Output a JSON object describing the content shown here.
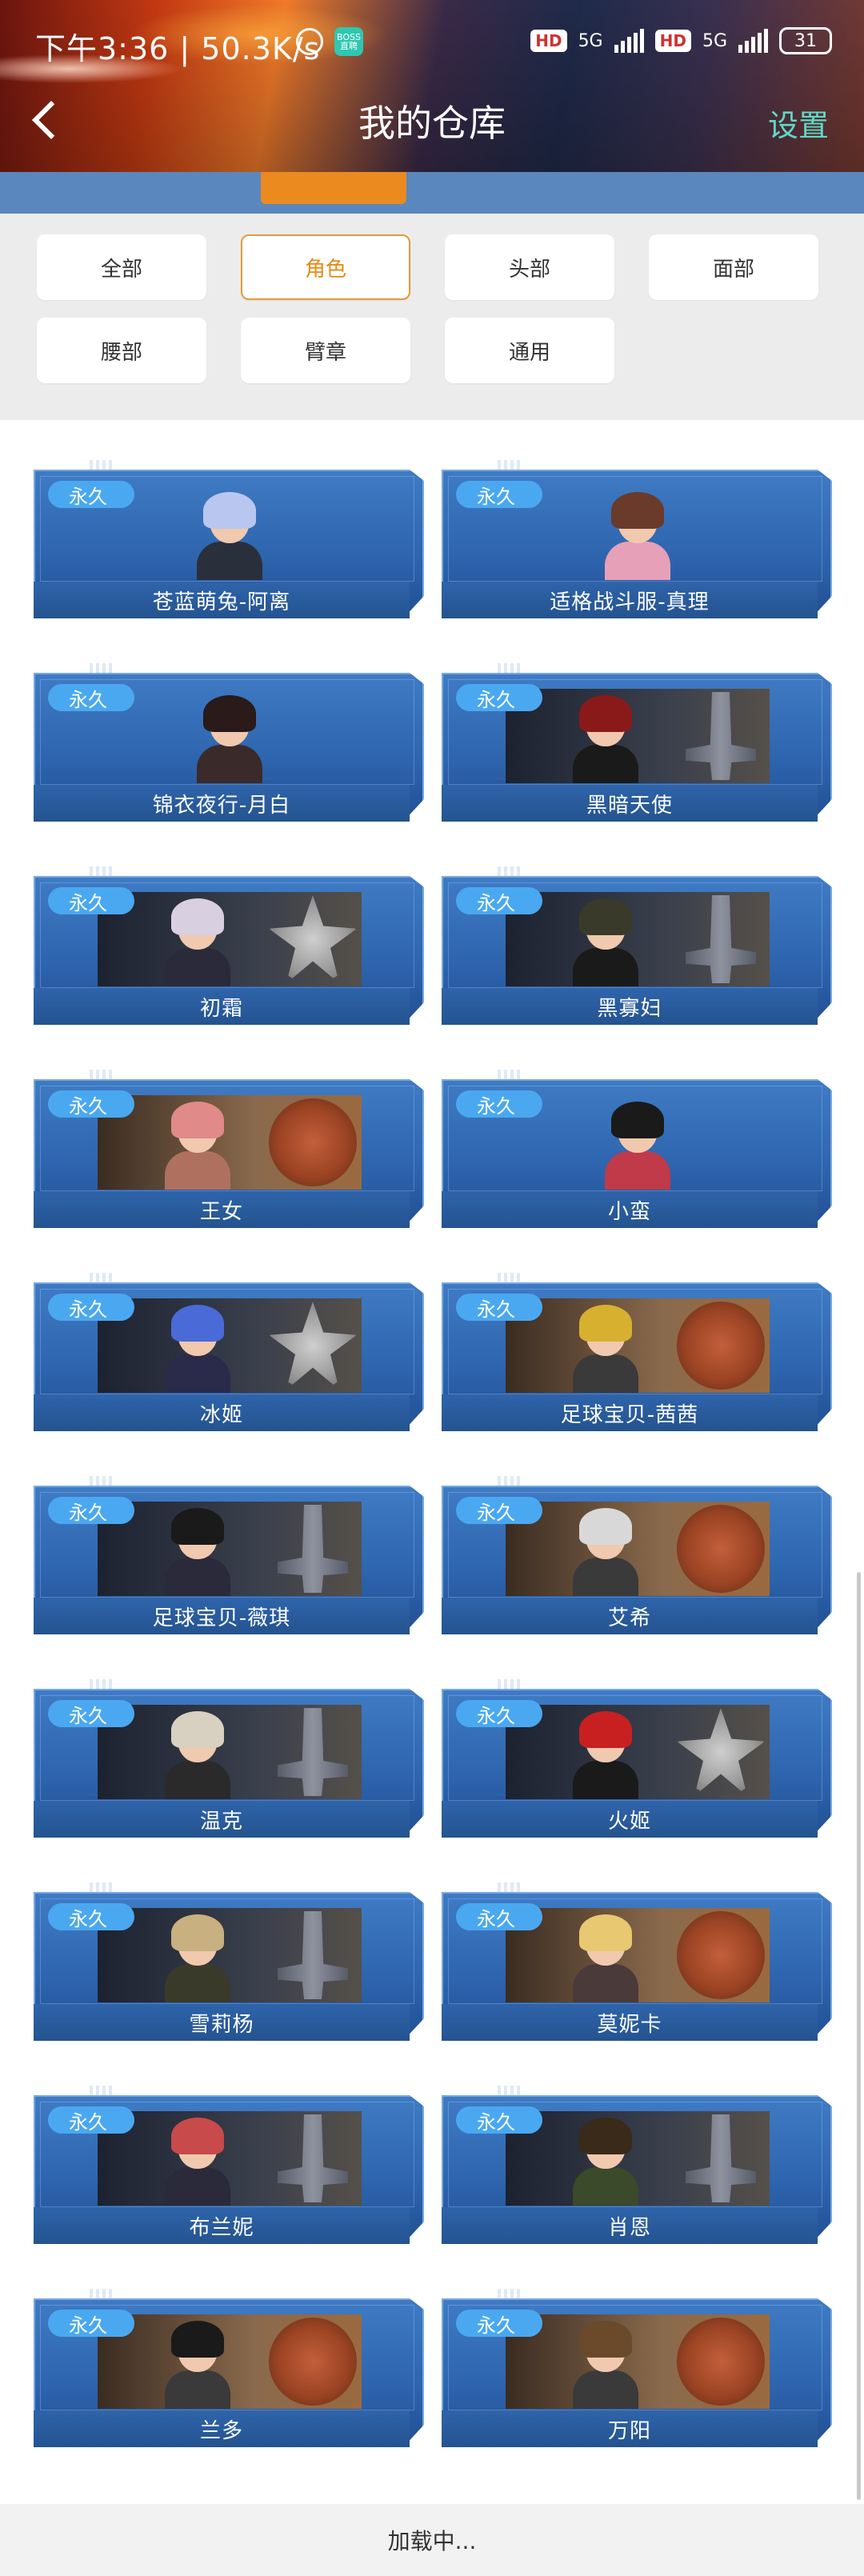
{
  "status_bar": {
    "time_speed": "下午3:36 | 50.3K/s",
    "boss_badge": "BOSS直聘",
    "hd1": "HD",
    "hd2": "HD",
    "net1": "5G",
    "net2": "5G",
    "battery": "31"
  },
  "header": {
    "title": "我的仓库",
    "settings": "设置"
  },
  "filters": {
    "active": "角色",
    "chips": [
      "全部",
      "角色",
      "头部",
      "面部",
      "腰部",
      "臂章",
      "通用"
    ]
  },
  "badge_label": "永久",
  "items": [
    {
      "name": "苍蓝萌兔-阿离",
      "label": "永久"
    },
    {
      "name": "适格战斗服-真理",
      "label": "永久"
    },
    {
      "name": "锦衣夜行-月白",
      "label": "永久"
    },
    {
      "name": "黑暗天使",
      "label": "永久"
    },
    {
      "name": "初霜",
      "label": "永久"
    },
    {
      "name": "黑寡妇",
      "label": "永久"
    },
    {
      "name": "王女",
      "label": "永久"
    },
    {
      "name": "小蛮",
      "label": "永久"
    },
    {
      "name": "冰姬",
      "label": "永久"
    },
    {
      "name": "足球宝贝-茜茜",
      "label": "永久"
    },
    {
      "name": "足球宝贝-薇琪",
      "label": "永久"
    },
    {
      "name": "艾希",
      "label": "永久"
    },
    {
      "name": "温克",
      "label": "永久"
    },
    {
      "name": "火姬",
      "label": "永久"
    },
    {
      "name": "雪莉杨",
      "label": "永久"
    },
    {
      "name": "莫妮卡",
      "label": "永久"
    },
    {
      "name": "布兰妮",
      "label": "永久"
    },
    {
      "name": "肖恩",
      "label": "永久"
    },
    {
      "name": "兰多",
      "label": "永久"
    },
    {
      "name": "万阳",
      "label": "永久"
    }
  ],
  "loading": "加载中...",
  "colors": {
    "tab_active": "#ea8a1f",
    "tabs_bar": "#5a87be",
    "card_blue": "#2d64ad",
    "badge_blue": "#4aa8f0",
    "settings_teal": "#5fd9c8",
    "chip_active": "#e88a14"
  }
}
